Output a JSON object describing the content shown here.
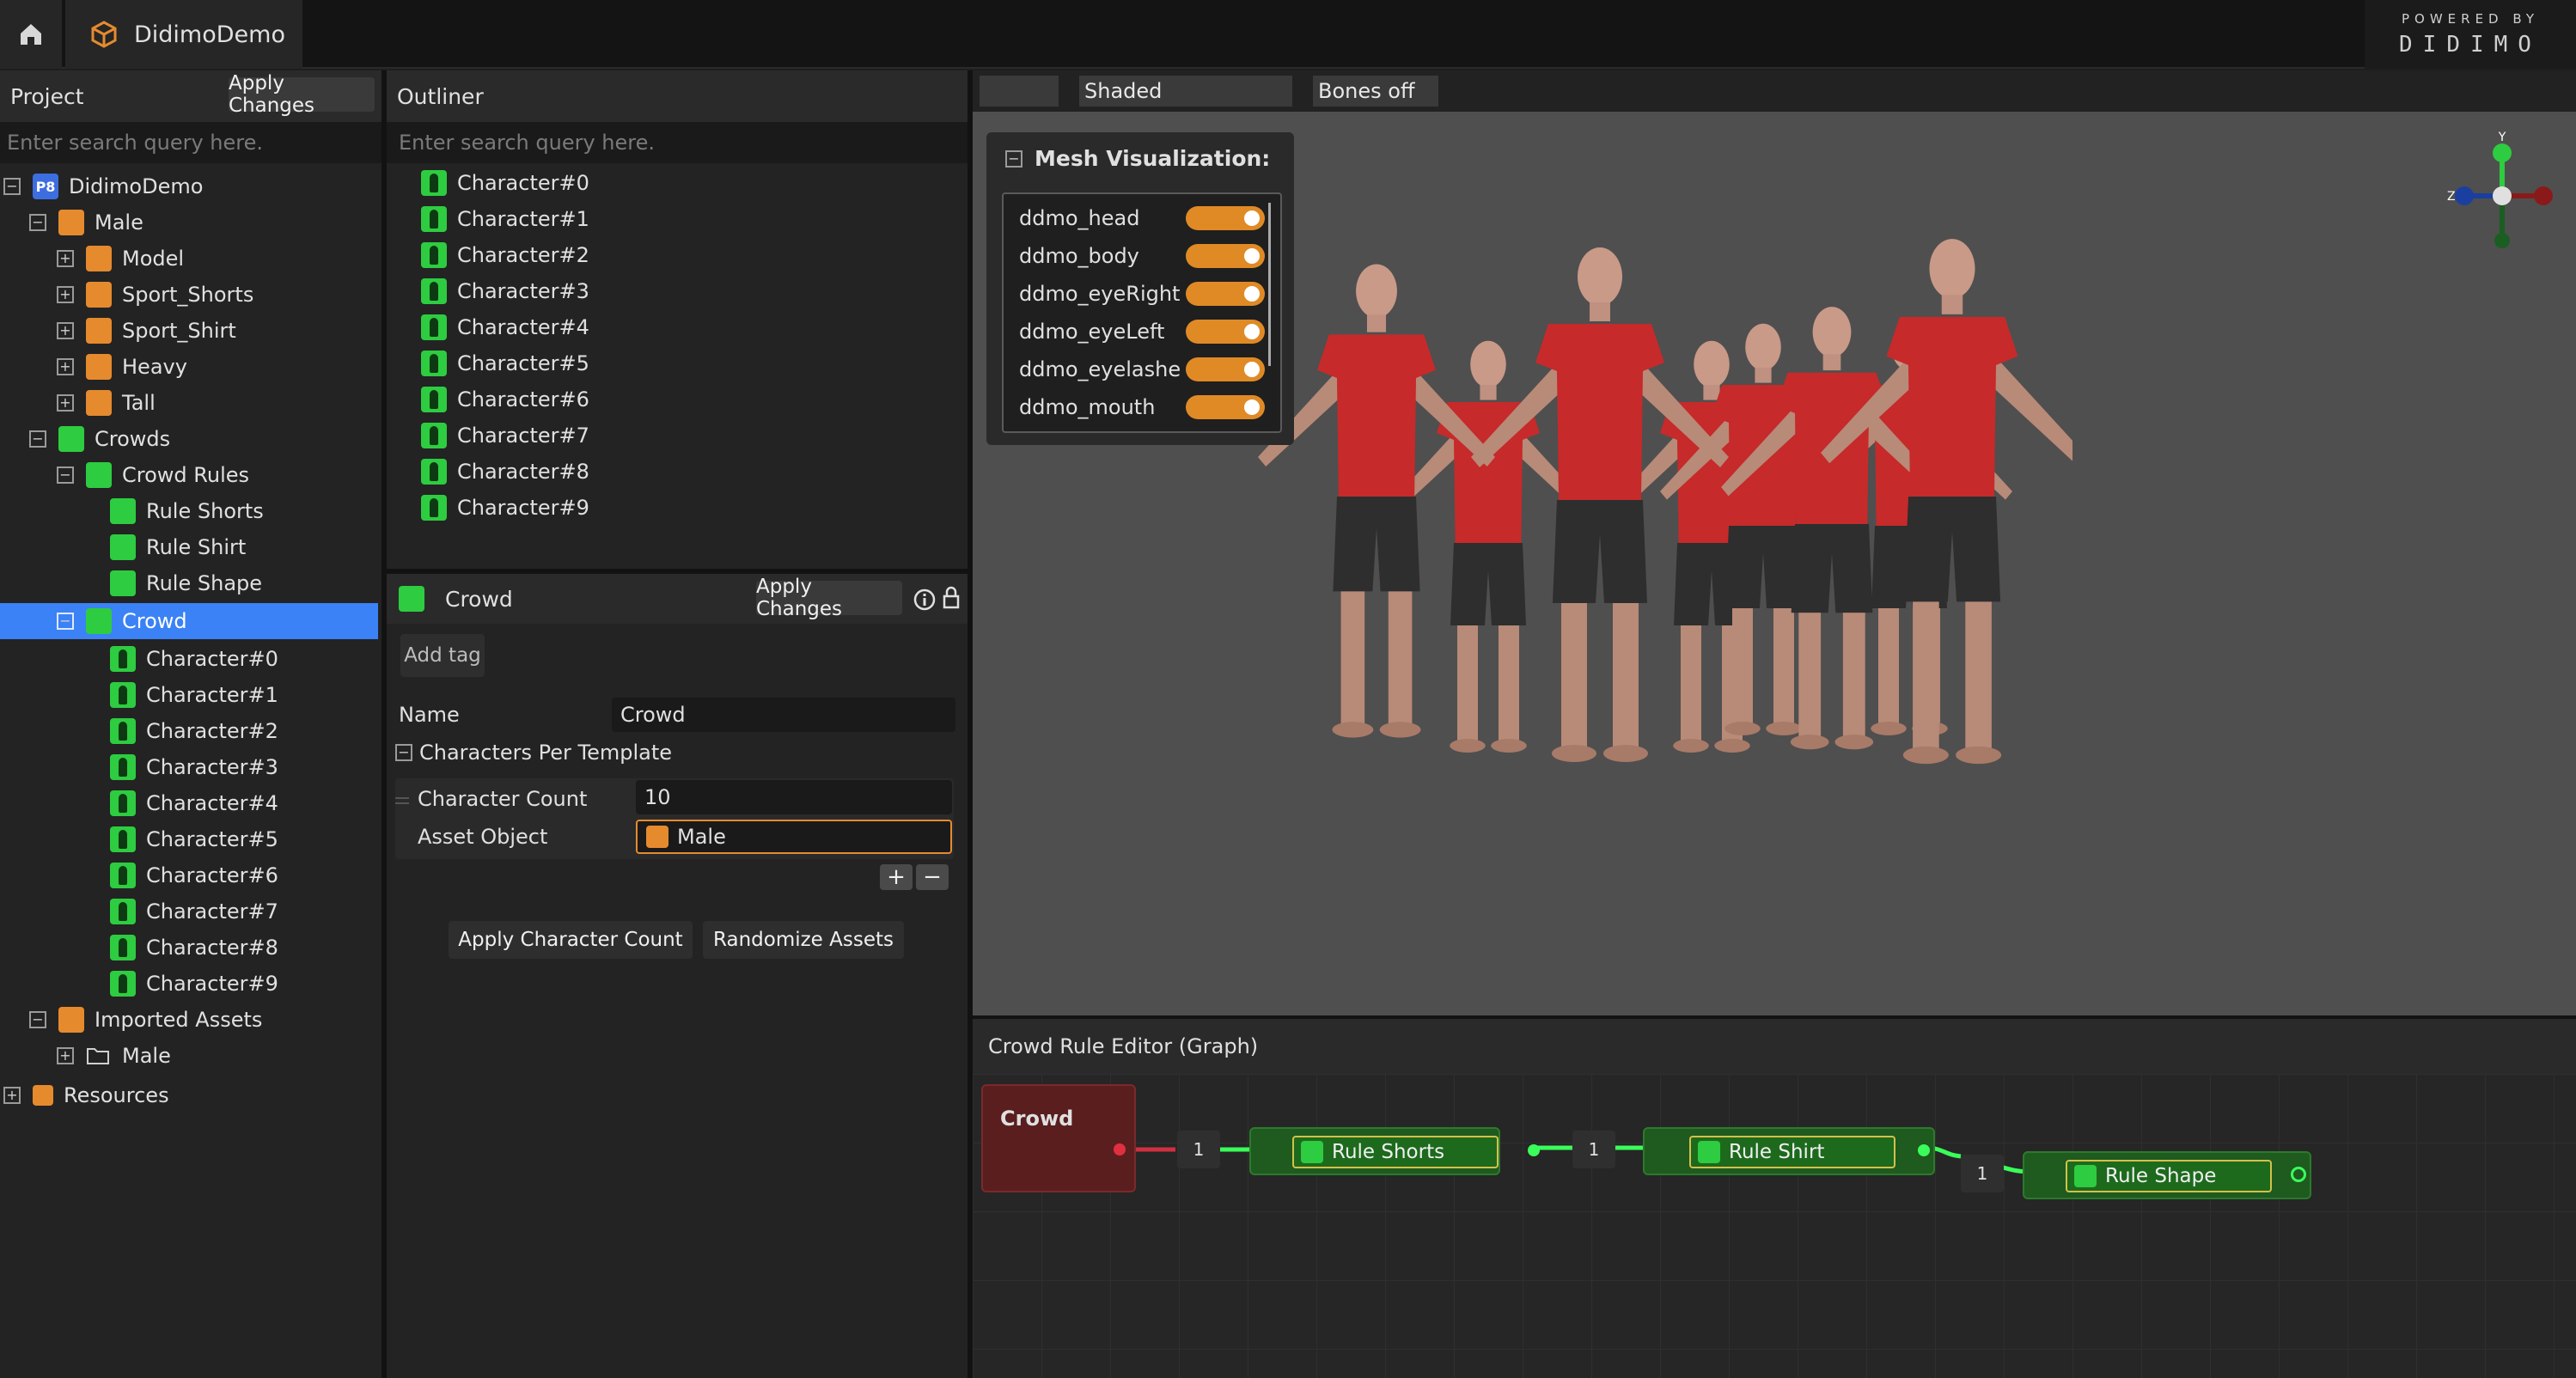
{
  "app": {
    "tab_title": "DidimoDemo",
    "powered_by": "POWERED BY",
    "brand": "DIDIMO"
  },
  "project": {
    "title": "Project",
    "apply_label": "Apply Changes",
    "search_placeholder": "Enter search query here.",
    "tree": {
      "root": "DidimoDemo",
      "male": "Male",
      "model": "Model",
      "sport_shorts": "Sport_Shorts",
      "sport_shirt": "Sport_Shirt",
      "heavy": "Heavy",
      "tall": "Tall",
      "crowds": "Crowds",
      "crowd_rules": "Crowd Rules",
      "rule_shorts": "Rule Shorts",
      "rule_shirt": "Rule Shirt",
      "rule_shape": "Rule Shape",
      "crowd": "Crowd",
      "characters": [
        "Character#0",
        "Character#1",
        "Character#2",
        "Character#3",
        "Character#4",
        "Character#5",
        "Character#6",
        "Character#7",
        "Character#8",
        "Character#9"
      ],
      "imported_assets": "Imported Assets",
      "imported_male": "Male",
      "resources": "Resources"
    }
  },
  "outliner": {
    "title": "Outliner",
    "search_placeholder": "Enter search query here.",
    "items": [
      "Character#0",
      "Character#1",
      "Character#2",
      "Character#3",
      "Character#4",
      "Character#5",
      "Character#6",
      "Character#7",
      "Character#8",
      "Character#9"
    ]
  },
  "props": {
    "title": "Crowd",
    "apply_label": "Apply Changes",
    "add_tag": "Add tag",
    "name_label": "Name",
    "name_value": "Crowd",
    "section": "Characters Per Template",
    "char_count_label": "Character Count",
    "char_count_value": "10",
    "asset_label": "Asset Object",
    "asset_value": "Male",
    "apply_count_btn": "Apply Character Count",
    "randomize_btn": "Randomize Assets"
  },
  "viewport": {
    "shading": "Shaded",
    "bones": "Bones off",
    "mesh_title": "Mesh Visualization:",
    "meshes": [
      "ddmo_head",
      "ddmo_body",
      "ddmo_eyeRight",
      "ddmo_eyeLeft",
      "ddmo_eyelashe",
      "ddmo_mouth"
    ],
    "gizmo": {
      "y": "Y",
      "z": "Z"
    }
  },
  "graph": {
    "title": "Crowd Rule Editor (Graph)",
    "crowd_node": "Crowd",
    "nodes": [
      "Rule Shorts",
      "Rule Shirt",
      "Rule Shape"
    ],
    "counts": [
      "1",
      "1",
      "1"
    ]
  },
  "colors": {
    "accent_orange": "#e68a2e",
    "accent_green": "#2ecc40",
    "selection": "#3b82f6",
    "crowd_node": "#5a1e1e"
  }
}
